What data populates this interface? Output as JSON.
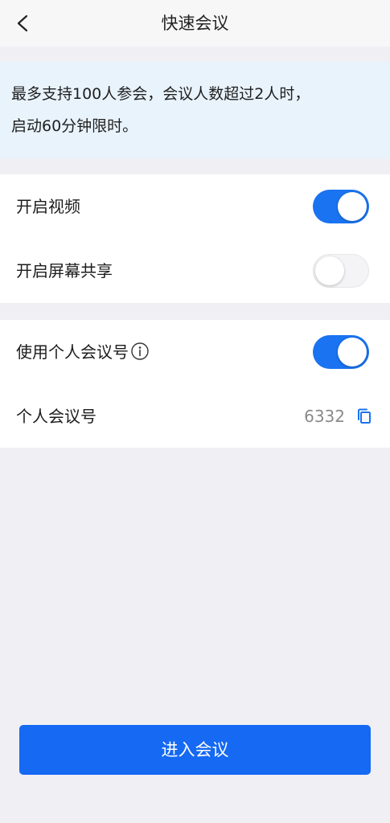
{
  "header": {
    "title": "快速会议",
    "back_icon": "chevron-left-icon"
  },
  "notice": {
    "line1": "最多支持100人参会，会议人数超过2人时，",
    "line2": "启动60分钟限时。"
  },
  "settings": {
    "video": {
      "label": "开启视频",
      "enabled": true
    },
    "screen_share": {
      "label": "开启屏幕共享",
      "enabled": false
    }
  },
  "personal": {
    "use_personal_id": {
      "label": "使用个人会议号",
      "enabled": true,
      "icon": "info-icon"
    },
    "meeting_id": {
      "label": "个人会议号",
      "value": "6332",
      "icon": "copy-icon"
    }
  },
  "footer": {
    "enter_label": "进入会议"
  },
  "colors": {
    "accent": "#1a73f0",
    "button": "#1569f2",
    "notice_bg": "#e9f3fc",
    "page_bg": "#efeff4"
  }
}
